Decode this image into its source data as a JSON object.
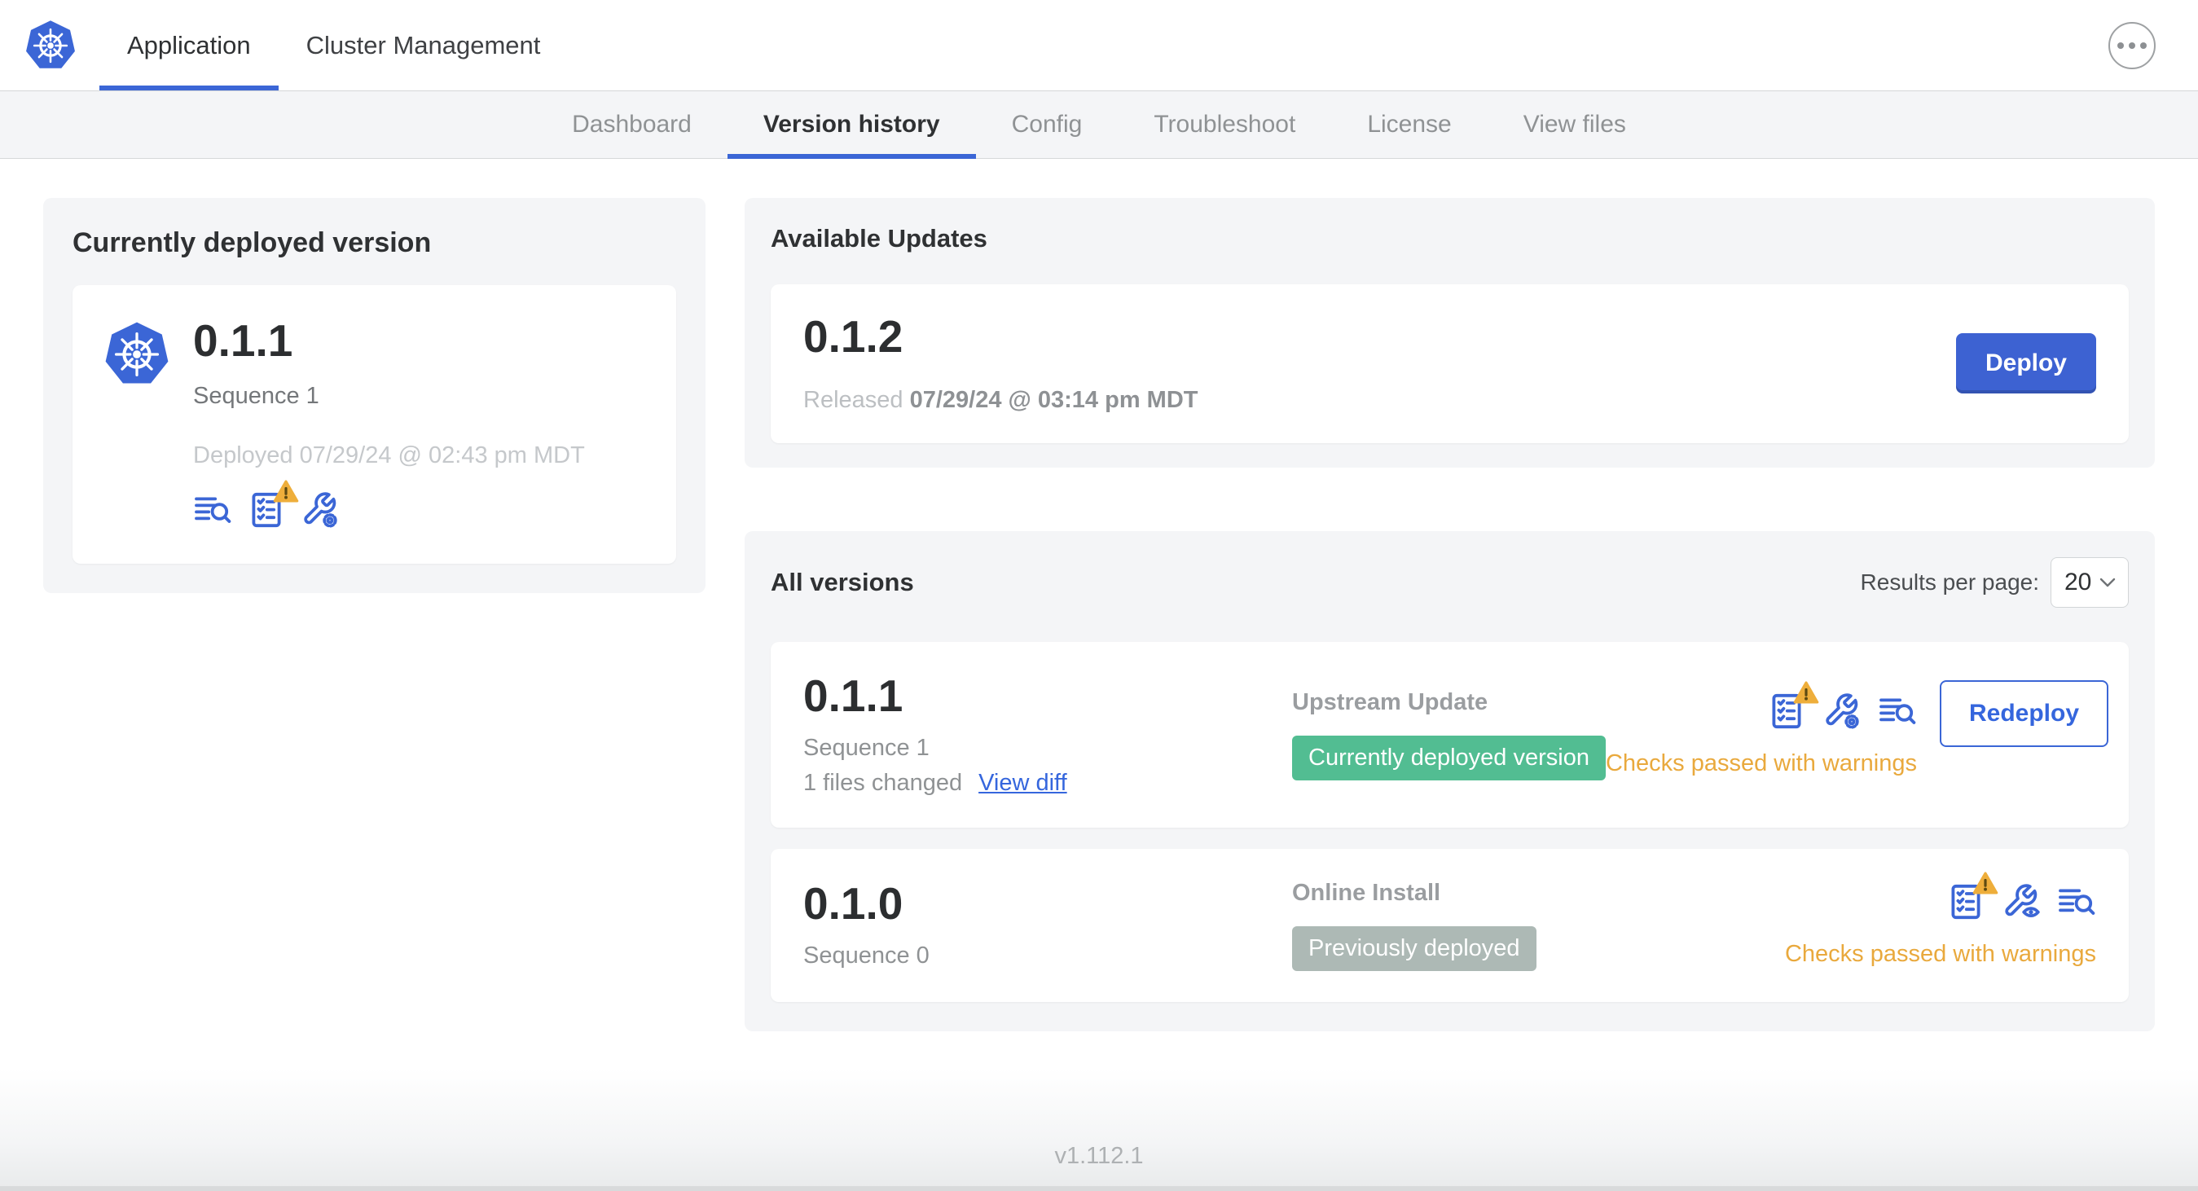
{
  "colors": {
    "accent_blue": "#3b66d6",
    "warning_amber": "#eeae3b",
    "badge_green": "#52bd92",
    "badge_gray": "#adb9b5",
    "panel_gray": "#f4f5f7"
  },
  "icons": {
    "app_logo": "kubernetes-helm-wheel",
    "more_menu": "ellipsis-in-circle",
    "deploy_logs": "lines-with-magnifier",
    "preflight_checks": "checklist-clipboard",
    "config": "wrench-with-gear",
    "config_view": "wrench-with-eye",
    "warning": "triangle-exclamation",
    "select_chevron": "chevron-down"
  },
  "header": {
    "tabs": [
      "Application",
      "Cluster Management"
    ]
  },
  "subnav": {
    "tabs": [
      "Dashboard",
      "Version history",
      "Config",
      "Troubleshoot",
      "License",
      "View files"
    ],
    "active": "Version history"
  },
  "current_version": {
    "title": "Currently deployed version",
    "version": "0.1.1",
    "sequence": "Sequence 1",
    "deployed": "Deployed 07/29/24 @ 02:43 pm MDT"
  },
  "available_updates": {
    "title": "Available Updates",
    "version": "0.1.2",
    "released_prefix": "Released",
    "released_date": "07/29/24 @ 03:14 pm MDT",
    "deploy_label": "Deploy"
  },
  "all_versions": {
    "title": "All versions",
    "results_per_page_label": "Results per page:",
    "results_per_page_value": "20",
    "rows": [
      {
        "version": "0.1.1",
        "sequence": "Sequence 1",
        "files_changed": "1 files changed",
        "view_diff": "View diff",
        "source": "Upstream Update",
        "badge": "Currently deployed version",
        "checks": "Checks passed with warnings",
        "action": "Redeploy"
      },
      {
        "version": "0.1.0",
        "sequence": "Sequence 0",
        "source": "Online Install",
        "badge": "Previously deployed",
        "checks": "Checks passed with warnings"
      }
    ]
  },
  "footer": {
    "version": "v1.112.1"
  }
}
